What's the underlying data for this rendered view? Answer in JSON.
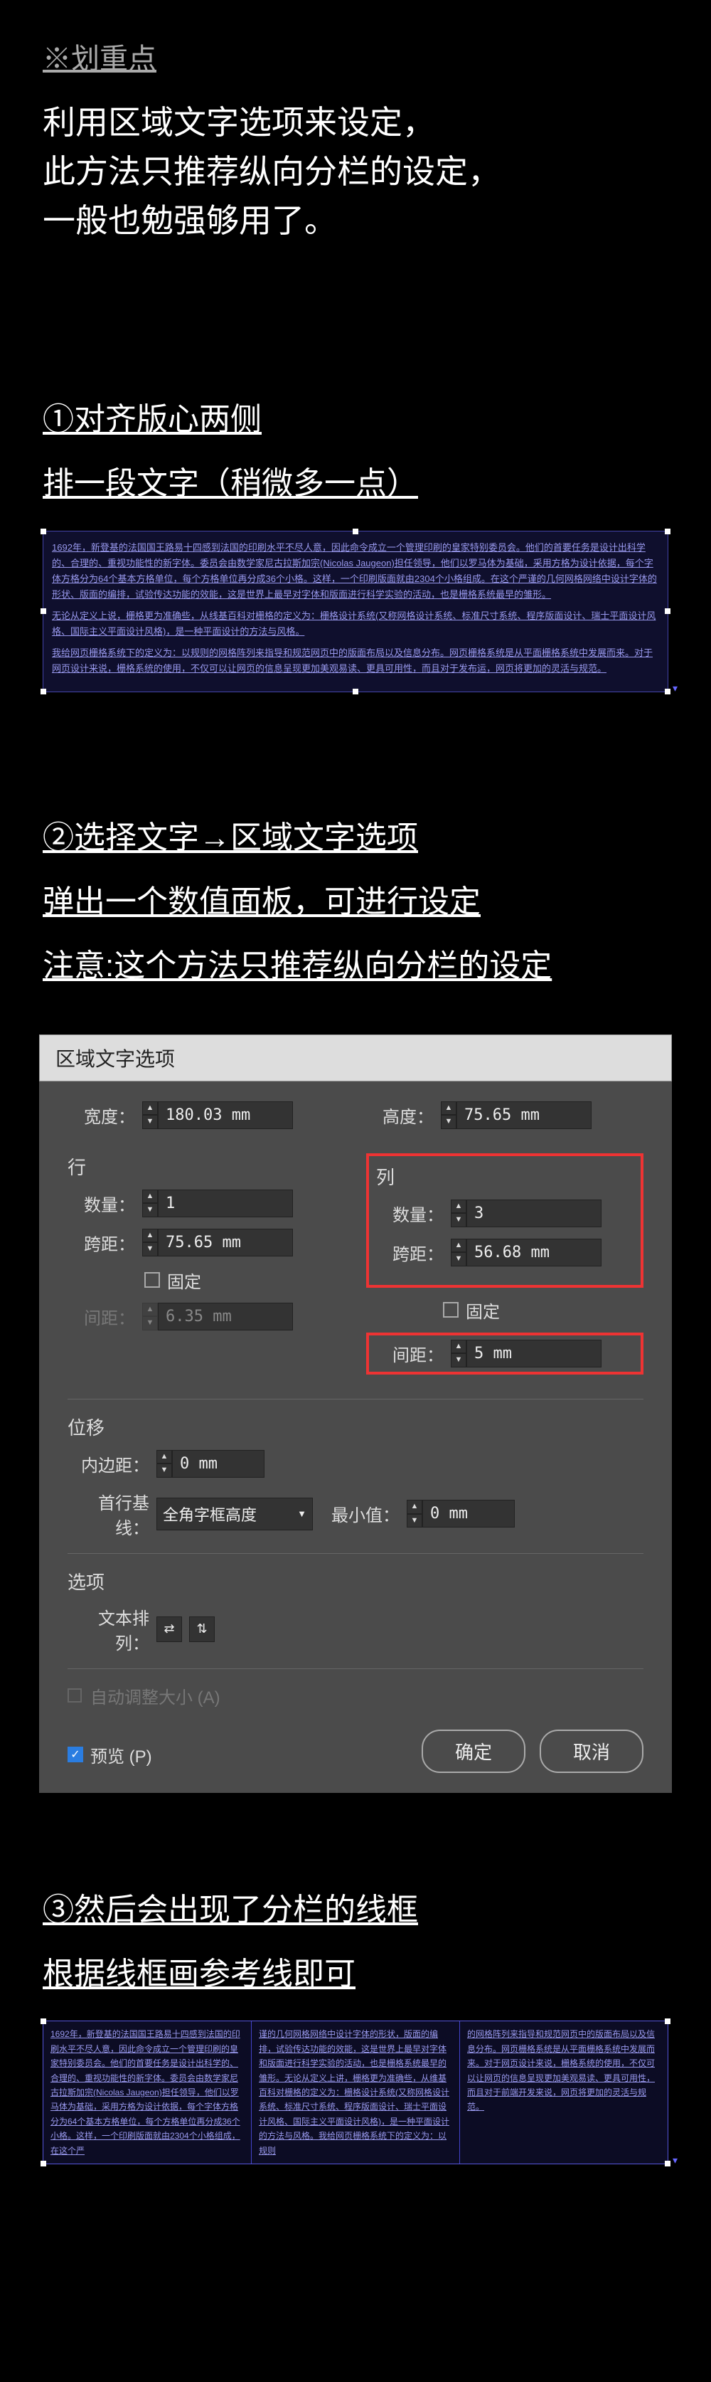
{
  "highlight": {
    "title": "※划重点",
    "intro": "利用区域文字选项来设定，\n此方法只推荐纵向分栏的设定，\n一般也勉强够用了。"
  },
  "step1": {
    "title": "①对齐版心两侧",
    "sub": "排一段文字（稍微多一点）",
    "demo_para1": "1692年，新登基的法国国王路易十四感到法国的印刷水平不尽人意，因此命令成立一个管理印刷的皇家特别委员会。他们的首要任务是设计出科学的、合理的、重视功能性的新字体。委员会由数学家尼古拉斯加宗(Nicolas Jaugeon)担任领导，他们以罗马体为基础，采用方格为设计依据，每个字体方格分为64个基本方格单位，每个方格单位再分成36个小格。这样，一个印刷版面就由2304个小格组成。在这个严谨的几何网格网络中设计字体的形状、版面的编排，试验传达功能的效能，这是世界上最早对字体和版面进行科学实验的活动，也是栅格系统最早的雏形。",
    "demo_para2": "无论从定义上说，栅格更为准确些，从线基百科对栅格的定义为：栅格设计系统(又称网格设计系统、标准尺寸系统、程序版面设计、瑞士平面设计风格、国际主义平面设计风格)，是一种平面设计的方法与风格。",
    "demo_para3": "我给网页栅格系统下的定义为：以规则的网格阵列来指导和规范网页中的版面布局以及信息分布。网页栅格系统是从平面栅格系统中发展而来。对于网页设计来说，栅格系统的使用，不仅可以让网页的信息呈现更加美观易读、更具可用性，而且对于发布运，网页将更加的灵活与规范。"
  },
  "step2": {
    "title": "②选择文字→区域文字选项",
    "sub1": "弹出一个数值面板，可进行设定",
    "sub2": "注意:这个方法只推荐纵向分栏的设定"
  },
  "dialog": {
    "title": "区域文字选项",
    "width_label": "宽度：",
    "width_value": "180.03 mm",
    "height_label": "高度：",
    "height_value": "75.65 mm",
    "row_section": "行",
    "col_section": "列",
    "count_label": "数量：",
    "row_count": "1",
    "col_count": "3",
    "span_label": "跨距：",
    "row_span": "75.65 mm",
    "col_span": "56.68 mm",
    "fixed_label": "固定",
    "gap_label": "间距：",
    "row_gap": "6.35 mm",
    "col_gap": "5 mm",
    "offset_section": "位移",
    "inset_label": "内边距：",
    "inset_value": "0 mm",
    "baseline_label": "首行基线：",
    "baseline_value": "全角字框高度",
    "min_label": "最小值：",
    "min_value": "0 mm",
    "options_section": "选项",
    "textflow_label": "文本排列：",
    "auto_label": "自动调整大小 (A)",
    "preview_label": "预览 (P)",
    "ok": "确定",
    "cancel": "取消"
  },
  "step3": {
    "title": "③然后会出现了分栏的线框",
    "sub": "根据线框画参考线即可",
    "col1": "1692年，新登基的法国国王路易十四感到法国的印刷水平不尽人意，因此命令成立一个管理印刷的皇家特别委员会。他们的首要任务是设计出科学的、合理的、重视功能性的新字体。委员会由数学家尼古拉斯加宗(Nicolas Jaugeon)担任领导，他们以罗马体为基础，采用方格为设计依据，每个字体方格分为64个基本方格单位，每个方格单位再分成36个小格。这样，一个印刷版面就由2304个小格组成，在这个严",
    "col2": "谨的几何网格网络中设计字体的形状，版面的编排，试验传达功能的效能，这是世界上最早对字体和版面进行科学实验的活动，也是栅格系统最早的雏形。无论从定义上讲，栅格更为准确些，从维基百科对栅格的定义为：栅格设计系统(又称网格设计系统、标准尺寸系统、程序版面设计、瑞士平面设计风格、国际主义平面设计风格)，是一种平面设计的方法与风格。我给网页栅格系统下的定义为：以规则",
    "col3": "的网格阵列来指导和规范网页中的版面布局以及信息分布。网页栅格系统是从平面栅格系统中发展而来。对于网页设计来说，栅格系统的使用，不仅可以让网页的信息呈现更加美观易读、更具可用性，而且对于前端开发来说，网页将更加的灵活与规范。"
  }
}
